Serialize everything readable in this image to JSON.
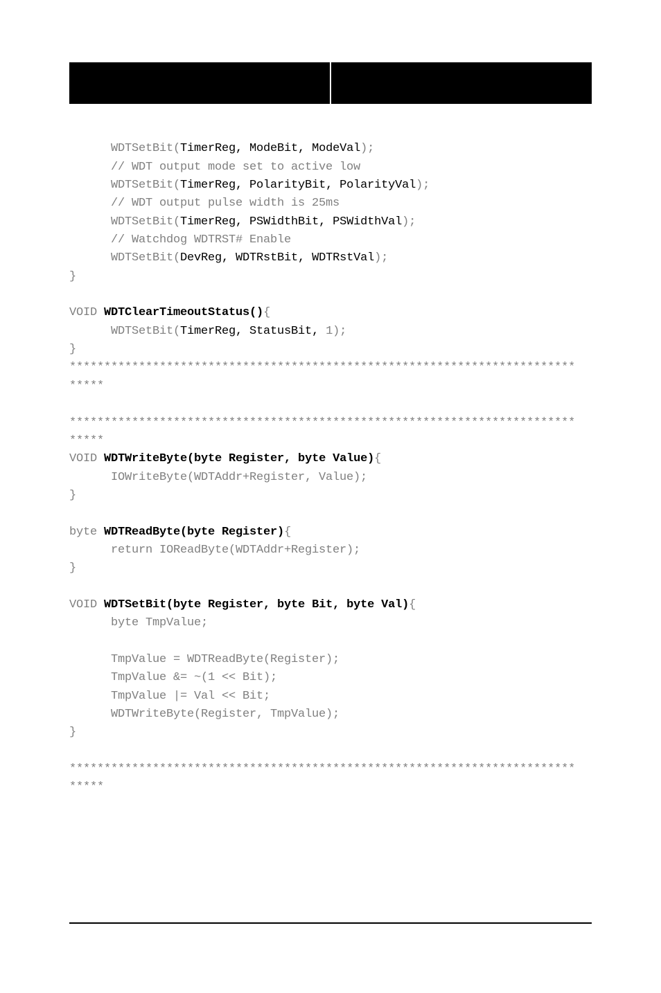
{
  "code": {
    "l1_a": "WDTSetBit(",
    "l1_b": "TimerReg, ModeBit, ModeVal",
    "l1_c": ");",
    "l2": "// WDT output mode set to active low",
    "l3_a": "WDTSetBit(",
    "l3_b": "TimerReg, PolarityBit, PolarityVal",
    "l3_c": ");",
    "l4": "// WDT output pulse width is 25ms",
    "l5_a": "WDTSetBit(",
    "l5_b": "TimerReg, PSWidthBit, PSWidthVal",
    "l5_c": ");",
    "l6": "// Watchdog WDTRST# Enable",
    "l7_a": "WDTSetBit(",
    "l7_b": "DevReg, WDTRstBit, WDTRstVal",
    "l7_c": ");",
    "l8": "}",
    "l9_a": "VOID ",
    "l9_b": "WDTClearTimeoutStatus()",
    "l9_c": "{",
    "l10_a": "WDTSetBit(",
    "l10_b": "TimerReg, StatusBit,",
    "l10_c": " 1);",
    "l11": "}",
    "stars_long": "*************************************************************************",
    "stars_short": "*****",
    "l12_a": "VOID ",
    "l12_b": "WDTWriteByte(byte Register, byte Value)",
    "l12_c": "{",
    "l13": "IOWriteByte(WDTAddr+Register, Value);",
    "l14": "}",
    "l15_a": "byte ",
    "l15_b": "WDTReadByte(byte Register)",
    "l15_c": "{",
    "l16": "return IOReadByte(WDTAddr+Register);",
    "l17": "}",
    "l18_a": "VOID ",
    "l18_b": "WDTSetBit(byte Register, byte Bit, byte Val)",
    "l18_c": "{",
    "l19": "byte TmpValue;",
    "l20": "TmpValue = WDTReadByte(Register);",
    "l21": "TmpValue &= ~(1 << Bit);",
    "l22": "TmpValue |= Val << Bit;",
    "l23": "WDTWriteByte(Register, TmpValue);",
    "l24": "}"
  }
}
